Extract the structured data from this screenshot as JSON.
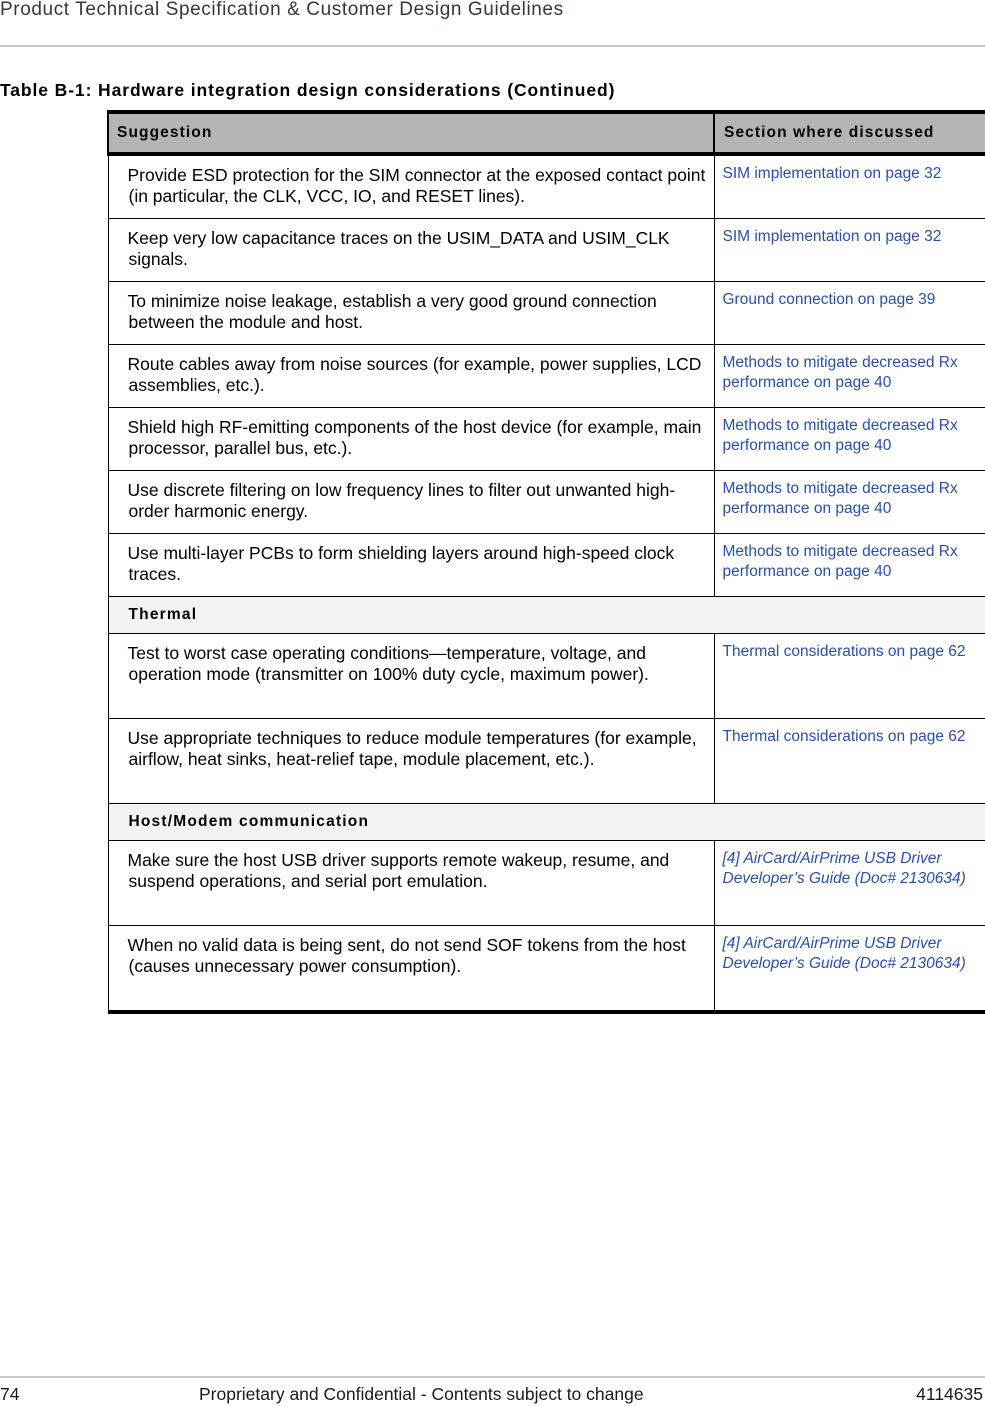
{
  "header": {
    "title": "Product Technical Specification & Customer Design Guidelines"
  },
  "table": {
    "caption": "Table B-1:  Hardware integration design considerations (Continued)",
    "columns": [
      "Suggestion",
      "Section where discussed"
    ],
    "rows": [
      {
        "type": "row",
        "suggestion": "Provide ESD protection for the SIM connector at the exposed contact point (in particular, the CLK, VCC, IO, and RESET lines).",
        "section": "SIM implementation on page 32"
      },
      {
        "type": "row",
        "suggestion": "Keep very low capacitance traces on the USIM_DATA and USIM_CLK signals.",
        "section": "SIM implementation on page 32"
      },
      {
        "type": "row",
        "suggestion": "To minimize noise leakage, establish a very good ground connection between the module and host.",
        "section": "Ground connection on page 39"
      },
      {
        "type": "row",
        "suggestion": "Route cables away from noise sources (for example, power supplies, LCD assemblies, etc.).",
        "section": "Methods to mitigate decreased Rx performance on page 40"
      },
      {
        "type": "row",
        "suggestion": "Shield high RF-emitting components of the host device (for example, main processor, parallel bus, etc.).",
        "section": "Methods to mitigate decreased Rx performance on page 40"
      },
      {
        "type": "row",
        "suggestion": "Use discrete filtering on low frequency lines to filter out unwanted high-order harmonic energy.",
        "section": "Methods to mitigate decreased Rx performance on page 40"
      },
      {
        "type": "row",
        "suggestion": "Use multi-layer PCBs to form shielding layers around high-speed clock traces.",
        "section": "Methods to mitigate decreased Rx performance on page 40"
      },
      {
        "type": "group",
        "label": "Thermal"
      },
      {
        "type": "row",
        "suggestion": "Test to worst case operating conditions—temperature, voltage, and operation mode (transmitter on 100% duty cycle, maximum power).",
        "section": "Thermal considerations on page 62"
      },
      {
        "type": "row",
        "suggestion": "Use appropriate techniques to reduce module temperatures (for example, airflow, heat sinks, heat-relief tape, module placement, etc.).",
        "section": "Thermal considerations on page 62"
      },
      {
        "type": "group",
        "label": "Host/Modem communication"
      },
      {
        "type": "row",
        "suggestion": "Make sure the host USB driver supports remote wakeup, resume, and suspend operations, and serial port emulation.",
        "section": "[4] AirCard/AirPrime USB Driver Developer’s Guide (Doc# 2130634)",
        "italic": true
      },
      {
        "type": "row",
        "suggestion": "When no valid data is being sent, do not send SOF tokens from the host (causes unnecessary power consumption).",
        "section": "[4] AirCard/AirPrime USB Driver Developer’s Guide (Doc# 2130634)",
        "italic": true
      }
    ]
  },
  "footer": {
    "page_number": "74",
    "notice": "Proprietary and Confidential - Contents subject to change",
    "doc_number": "4114635"
  }
}
